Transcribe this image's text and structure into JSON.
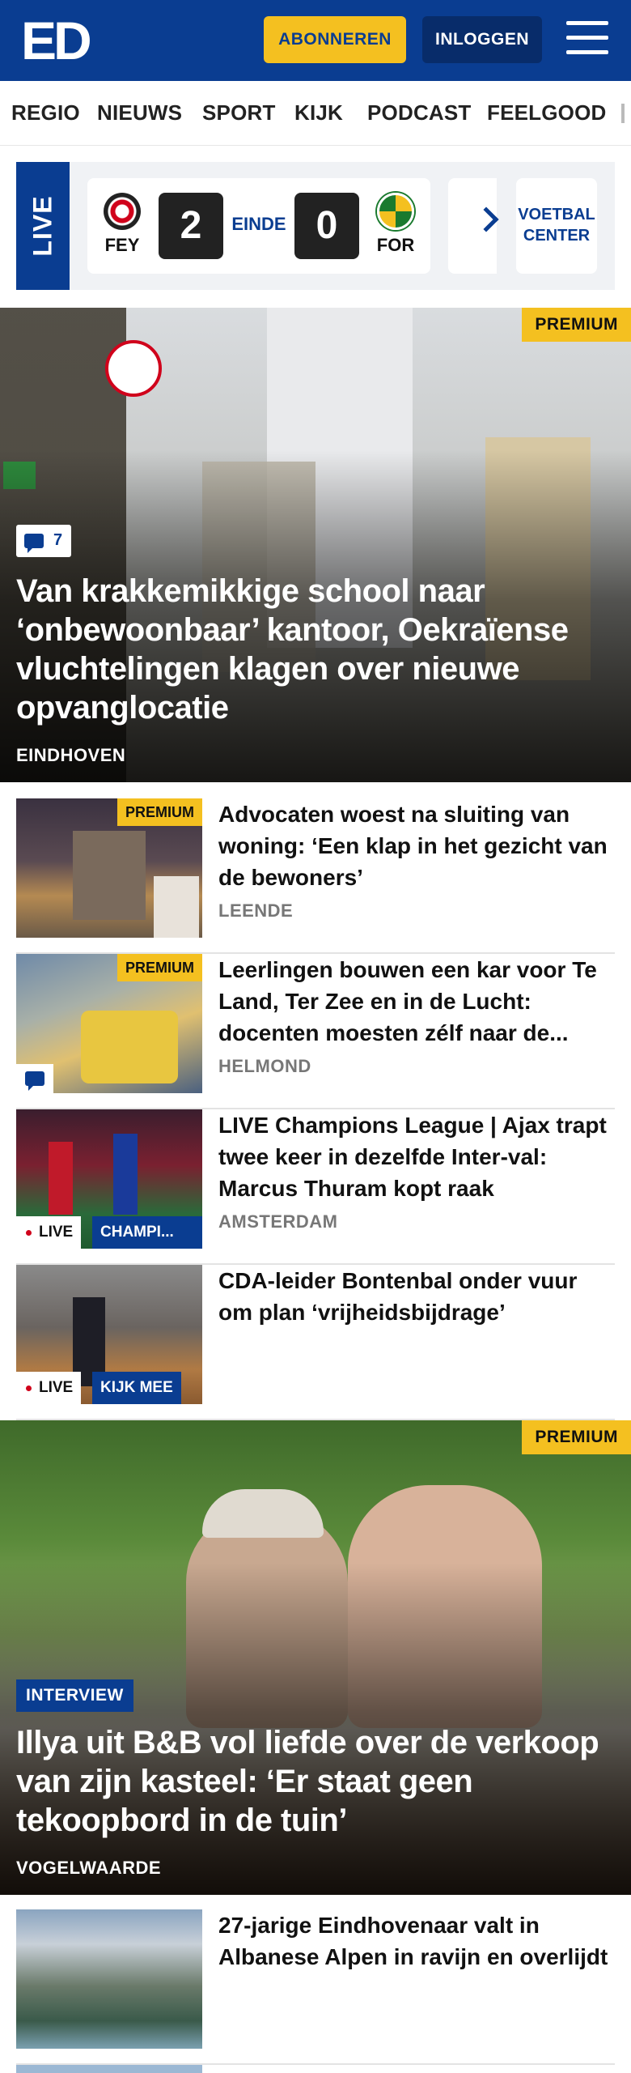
{
  "header": {
    "logo": "ED",
    "subscribe_label": "ABONNEREN",
    "login_label": "INLOGGEN"
  },
  "nav": {
    "items": [
      "REGIO",
      "NIEUWS",
      "SPORT",
      "KIJK",
      "PODCAST",
      "FEELGOOD"
    ]
  },
  "live": {
    "tab_label": "LIVE",
    "home_team": "FEY",
    "away_team": "FOR",
    "home_score": "2",
    "away_score": "0",
    "status": "EINDE",
    "voetbal_center": "VOETBAL CENTER",
    "home_colors": [
      "#d0021b",
      "#ffffff"
    ],
    "away_colors": [
      "#f4c020",
      "#1a7a2e"
    ]
  },
  "hero1": {
    "premium_label": "PREMIUM",
    "comment_count": "7",
    "title": "Van krakkemikkige school naar ‘onbewoonbaar’ kantoor, Oekraïense vluchtelingen klagen over nieuwe opvanglocatie",
    "location": "EINDHOVEN"
  },
  "articles": [
    {
      "title": "Advocaten woest na sluiting van woning: ‘Een klap in het gezicht van de bewoners’",
      "location": "LEENDE",
      "premium_label": "PREMIUM"
    },
    {
      "title": "Leerlingen bouwen een kar voor Te Land, Ter Zee en in de Lucht: docenten moesten zélf naar de...",
      "location": "HELMOND",
      "premium_label": "PREMIUM"
    },
    {
      "title": "LIVE Champions League | Ajax trapt twee keer in dezelfde Inter-val: Marcus Thuram kopt raak",
      "location": "AMSTERDAM",
      "live_label": "LIVE",
      "section_label": "CHAMPI..."
    },
    {
      "title": "CDA-leider Bontenbal onder vuur om plan ‘vrijheidsbijdrage’",
      "live_label": "LIVE",
      "section_label": "KIJK MEE"
    }
  ],
  "hero2": {
    "premium_label": "PREMIUM",
    "tag": "INTERVIEW",
    "title": "Illya uit B&B vol liefde over de verkoop van zijn kasteel: ‘Er staat geen tekoopbord in de tuin’",
    "location": "VOGELWAARDE"
  },
  "article_last": {
    "title": "27-jarige Eindhovenaar valt in Albanese Alpen in ravijn en overlijdt"
  },
  "colors": {
    "brand_blue": "#0a3d91",
    "premium_yellow": "#f4c020",
    "live_red": "#d0021b"
  }
}
